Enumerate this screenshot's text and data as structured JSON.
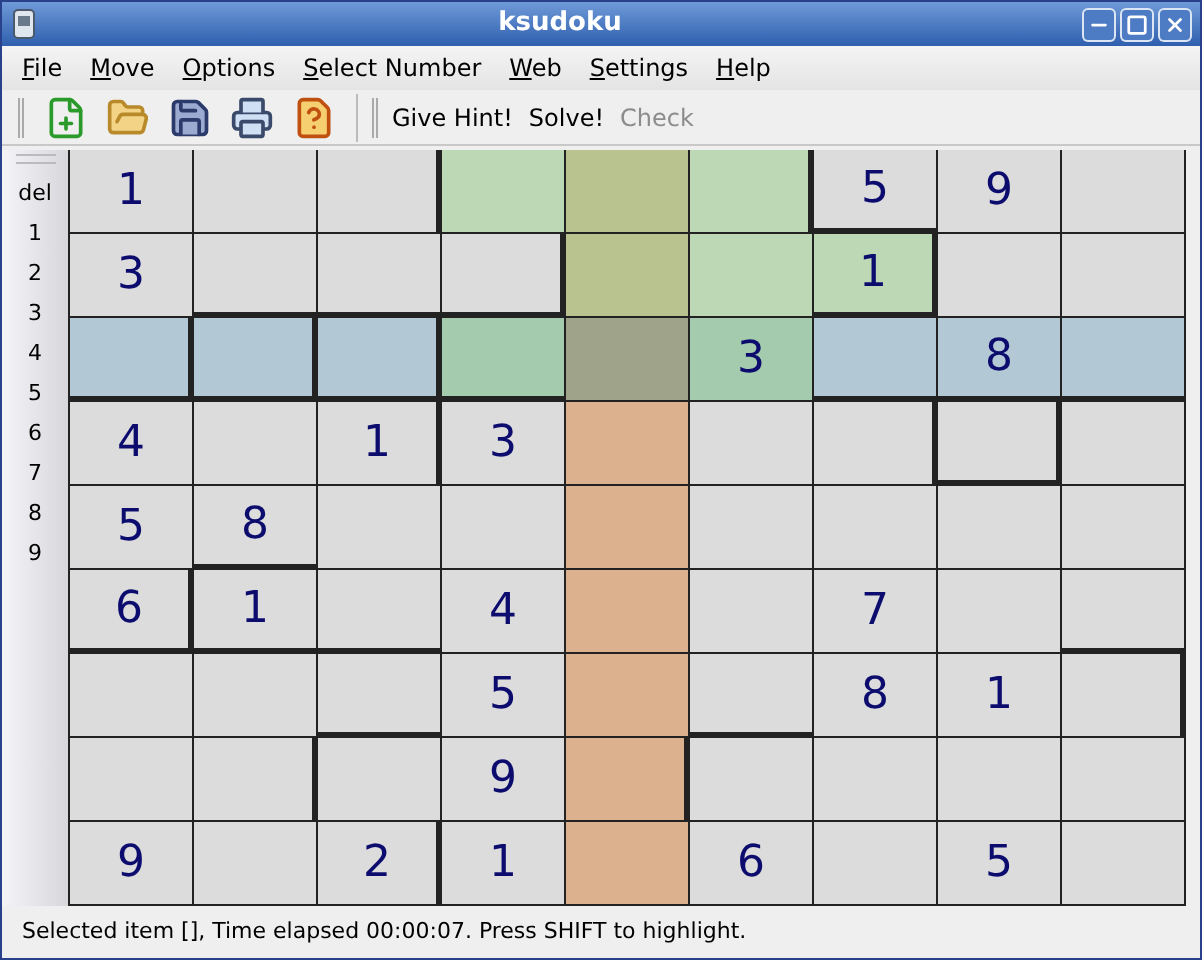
{
  "window": {
    "title": "ksudoku"
  },
  "menu": [
    "File",
    "Move",
    "Options",
    "Select Number",
    "Web",
    "Settings",
    "Help"
  ],
  "toolbar": {
    "text_buttons": [
      {
        "label": "Give Hint!",
        "disabled": false
      },
      {
        "label": "Solve!",
        "disabled": false
      },
      {
        "label": "Check",
        "disabled": true
      }
    ]
  },
  "number_bar": [
    "del",
    "1",
    "2",
    "3",
    "4",
    "5",
    "6",
    "7",
    "8",
    "9"
  ],
  "grid": [
    [
      {
        "value": "1",
        "color": "#dcdcdc"
      },
      {
        "color": "#dcdcdc"
      },
      {
        "color": "#dcdcdc"
      },
      {
        "color": "#bdd8b5"
      },
      {
        "color": "#b9c390"
      },
      {
        "color": "#bdd8b5"
      },
      {
        "value": "5",
        "color": "#dcdcdc"
      },
      {
        "value": "9",
        "color": "#dcdcdc"
      },
      {
        "color": "#dcdcdc"
      }
    ],
    [
      {
        "value": "3",
        "color": "#dcdcdc"
      },
      {
        "color": "#dcdcdc"
      },
      {
        "color": "#dcdcdc"
      },
      {
        "color": "#dcdcdc"
      },
      {
        "color": "#b9c390"
      },
      {
        "color": "#bdd8b5"
      },
      {
        "value": "1",
        "color": "#bdd8b5"
      },
      {
        "color": "#dcdcdc"
      },
      {
        "color": "#dcdcdc"
      }
    ],
    [
      {
        "color": "#b2c8d5"
      },
      {
        "color": "#b2c8d5"
      },
      {
        "color": "#b2c8d5"
      },
      {
        "color": "#a4cbad"
      },
      {
        "color": "#9ea38a"
      },
      {
        "value": "3",
        "color": "#a4cbad"
      },
      {
        "color": "#b2c8d5"
      },
      {
        "value": "8",
        "color": "#b2c8d5"
      },
      {
        "color": "#b2c8d5"
      }
    ],
    [
      {
        "value": "4",
        "color": "#dcdcdc"
      },
      {
        "color": "#dcdcdc"
      },
      {
        "value": "1",
        "color": "#dcdcdc"
      },
      {
        "value": "3",
        "color": "#dcdcdc"
      },
      {
        "color": "#dbb28d"
      },
      {
        "color": "#dcdcdc"
      },
      {
        "color": "#dcdcdc"
      },
      {
        "color": "#dcdcdc"
      },
      {
        "color": "#dcdcdc"
      }
    ],
    [
      {
        "value": "5",
        "color": "#dcdcdc"
      },
      {
        "value": "8",
        "color": "#dcdcdc"
      },
      {
        "color": "#dcdcdc"
      },
      {
        "color": "#dcdcdc"
      },
      {
        "color": "#dbb28d"
      },
      {
        "color": "#dcdcdc"
      },
      {
        "color": "#dcdcdc"
      },
      {
        "color": "#dcdcdc"
      },
      {
        "color": "#dcdcdc"
      }
    ],
    [
      {
        "value": "6",
        "color": "#dcdcdc"
      },
      {
        "value": "1",
        "color": "#dcdcdc"
      },
      {
        "color": "#dcdcdc"
      },
      {
        "value": "4",
        "color": "#dcdcdc"
      },
      {
        "color": "#dbb28d"
      },
      {
        "color": "#dcdcdc"
      },
      {
        "value": "7",
        "color": "#dcdcdc"
      },
      {
        "color": "#dcdcdc"
      },
      {
        "color": "#dcdcdc"
      }
    ],
    [
      {
        "color": "#dcdcdc"
      },
      {
        "color": "#dcdcdc"
      },
      {
        "color": "#dcdcdc"
      },
      {
        "value": "5",
        "color": "#dcdcdc"
      },
      {
        "color": "#dbb28d"
      },
      {
        "color": "#dcdcdc"
      },
      {
        "value": "8",
        "color": "#dcdcdc"
      },
      {
        "value": "1",
        "color": "#dcdcdc"
      },
      {
        "color": "#dcdcdc"
      }
    ],
    [
      {
        "color": "#dcdcdc"
      },
      {
        "color": "#dcdcdc"
      },
      {
        "color": "#dcdcdc"
      },
      {
        "value": "9",
        "color": "#dcdcdc"
      },
      {
        "color": "#dbb28d"
      },
      {
        "color": "#dcdcdc"
      },
      {
        "color": "#dcdcdc"
      },
      {
        "color": "#dcdcdc"
      },
      {
        "color": "#dcdcdc"
      }
    ],
    [
      {
        "value": "9",
        "color": "#dcdcdc"
      },
      {
        "color": "#dcdcdc"
      },
      {
        "value": "2",
        "color": "#dcdcdc"
      },
      {
        "value": "1",
        "color": "#dcdcdc"
      },
      {
        "color": "#dbb28d"
      },
      {
        "value": "6",
        "color": "#dcdcdc"
      },
      {
        "color": "#dcdcdc"
      },
      {
        "value": "5",
        "color": "#dcdcdc"
      },
      {
        "color": "#dcdcdc"
      }
    ]
  ],
  "status_bar": "Selected item [], Time elapsed 00:00:07. Press SHIFT to highlight."
}
